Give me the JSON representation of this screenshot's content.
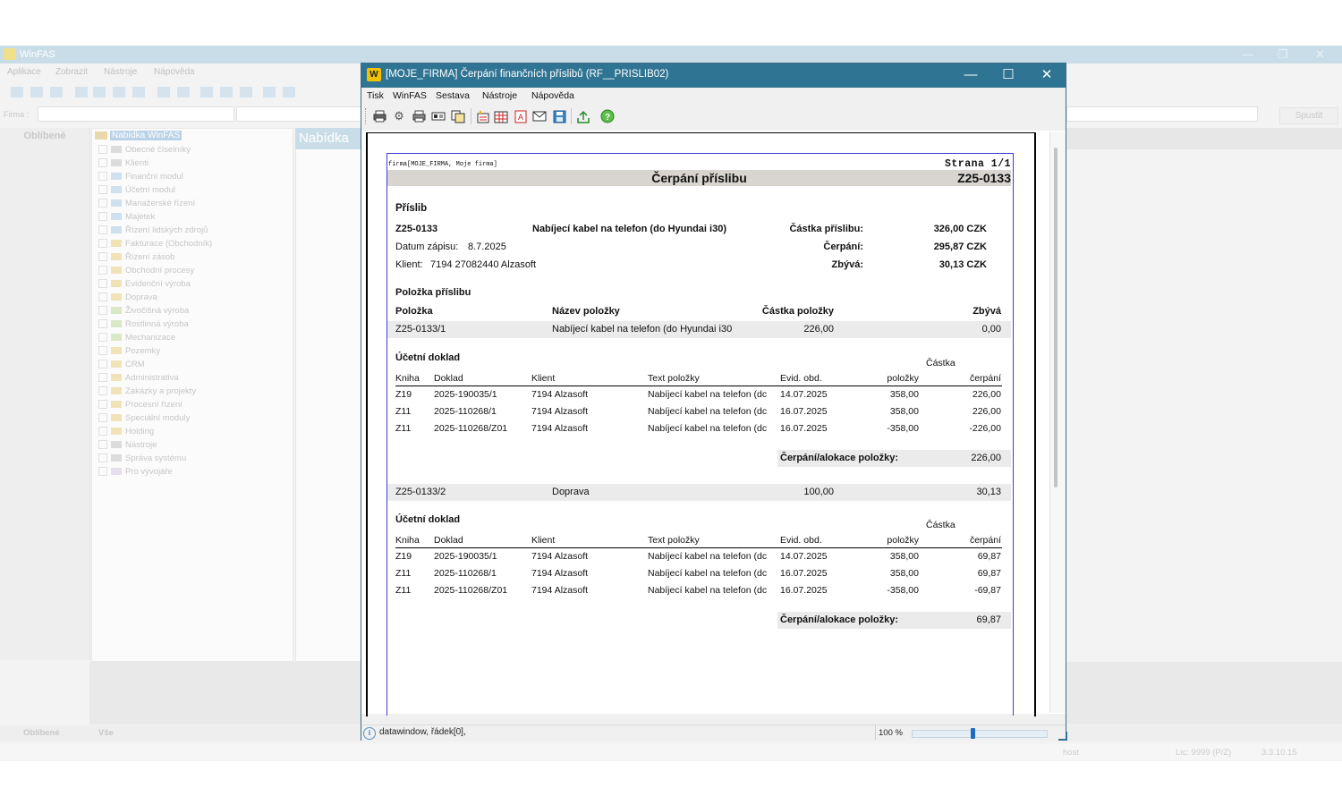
{
  "bg_app": {
    "title": "WinFAS",
    "menu": [
      "Aplikace",
      "Zobrazit",
      "Nástroje",
      "Nápověda"
    ],
    "firma_label": "Firma :",
    "spust_label": "Spustit",
    "favorites_title": "Oblíbené",
    "nabidka_title": "Nabídka",
    "tree_root": "Nabídka WinFAS",
    "tree_items": [
      "Obecné číselníky",
      "Klienti",
      "Finanční modul",
      "Účetní modul",
      "Manažerské řízení",
      "Majetek",
      "Řízení lidských zdrojů",
      "Fakturace (Obchodník)",
      "Řízení zásob",
      "Obchodní procesy",
      "Evidenční výroba",
      "Doprava",
      "Živočišná výroba",
      "Rostlinná výroba",
      "Mechanizace",
      "Pozemky",
      "CRM",
      "Administrativa",
      "Zakázky a projekty",
      "Procesní řízení",
      "Speciální moduly",
      "Holding",
      "Nástroje",
      "Správa systému",
      "Pro vývojáře"
    ],
    "tabs": [
      "Oblíbené",
      "Vše"
    ],
    "status": {
      "user": "host",
      "lic": "Lic: 9999 (P/Z)",
      "version": "3.3.10.15"
    }
  },
  "dialog": {
    "title": "[MOJE_FIRMA] Čerpání finančních příslibů (RF__PRISLIB02)",
    "icon_letter": "W",
    "menu": [
      "Tisk",
      "WinFAS",
      "Sestava",
      "Nástroje",
      "Nápověda"
    ],
    "status_text": "datawindow, řádek[0],",
    "zoom": "100 %",
    "zoom_level": 0.45
  },
  "report": {
    "firma_line": "firma[MOJE_FIRMA, Moje firma]",
    "page_label": "Strana 1/1",
    "title": "Čerpání příslibu",
    "doc_no": "Z25-0133",
    "section_prislib": "Příslib",
    "prislib_id": "Z25-0133",
    "prislib_name": "Nabíjecí kabel na telefon (do Hyundai i30)",
    "datum_label": "Datum zápisu:",
    "datum_value": "8.7.2025",
    "klient_label": "Klient:",
    "klient_value": "7194 27082440 Alzasoft",
    "castka_label": "Částka příslibu:",
    "castka_value": "326,00 CZK",
    "cerpani_label": "Čerpání:",
    "cerpani_value": "295,87 CZK",
    "zbyva_label": "Zbývá:",
    "zbyva_value": "30,13 CZK",
    "polozka_section": "Položka příslibu",
    "item_headers": {
      "polozka": "Položka",
      "nazev": "Název položky",
      "castka": "Částka položky",
      "zbyva": "Zbývá"
    },
    "ucetni_doklad": "Účetní doklad",
    "doc_headers": {
      "kniha": "Kniha",
      "doklad": "Doklad",
      "klient": "Klient",
      "text": "Text položky",
      "evid": "Evid. obd.",
      "castka_top": "Částka",
      "polozky": "položky",
      "cerpani": "čerpání"
    },
    "summary_label": "Čerpání/alokace položky:",
    "items": [
      {
        "polozka": "Z25-0133/1",
        "nazev": "Nabíjecí kabel na telefon (do Hyundai i30",
        "castka": "226,00",
        "zbyva": "0,00",
        "rows": [
          {
            "kniha": "Z19",
            "doklad": "2025-190035/1",
            "klient": "7194 Alzasoft",
            "text": "Nabíjecí kabel na telefon (dc",
            "evid": "14.07.2025",
            "polozky": "358,00",
            "cerpani": "226,00"
          },
          {
            "kniha": "Z11",
            "doklad": "2025-110268/1",
            "klient": "7194 Alzasoft",
            "text": "Nabíjecí kabel na telefon (dc",
            "evid": "16.07.2025",
            "polozky": "358,00",
            "cerpani": "226,00"
          },
          {
            "kniha": "Z11",
            "doklad": "2025-110268/Z01",
            "klient": "7194 Alzasoft",
            "text": "Nabíjecí kabel na telefon (dc",
            "evid": "16.07.2025",
            "polozky": "-358,00",
            "cerpani": "-226,00"
          }
        ],
        "summary": "226,00"
      },
      {
        "polozka": "Z25-0133/2",
        "nazev": "Doprava",
        "castka": "100,00",
        "zbyva": "30,13",
        "rows": [
          {
            "kniha": "Z19",
            "doklad": "2025-190035/1",
            "klient": "7194 Alzasoft",
            "text": "Nabíjecí kabel na telefon (dc",
            "evid": "14.07.2025",
            "polozky": "358,00",
            "cerpani": "69,87"
          },
          {
            "kniha": "Z11",
            "doklad": "2025-110268/1",
            "klient": "7194 Alzasoft",
            "text": "Nabíjecí kabel na telefon (dc",
            "evid": "16.07.2025",
            "polozky": "358,00",
            "cerpani": "69,87"
          },
          {
            "kniha": "Z11",
            "doklad": "2025-110268/Z01",
            "klient": "7194 Alzasoft",
            "text": "Nabíjecí kabel na telefon (dc",
            "evid": "16.07.2025",
            "polozky": "-358,00",
            "cerpani": "-69,87"
          }
        ],
        "summary": "69,87"
      }
    ]
  },
  "colors": {
    "titlebar": "#2f7493",
    "accent_yellow": "#f2c200",
    "band": "#d8d5d0",
    "row_band": "#ebebeb",
    "page_border": "#3b3bd6"
  },
  "icons": [
    "print-icon",
    "settings-icon",
    "printer-icon",
    "preview-icon",
    "copy-icon",
    "new-icon",
    "grid-icon",
    "pdf-icon",
    "mail-icon",
    "save-icon",
    "export-icon",
    "help-icon"
  ]
}
